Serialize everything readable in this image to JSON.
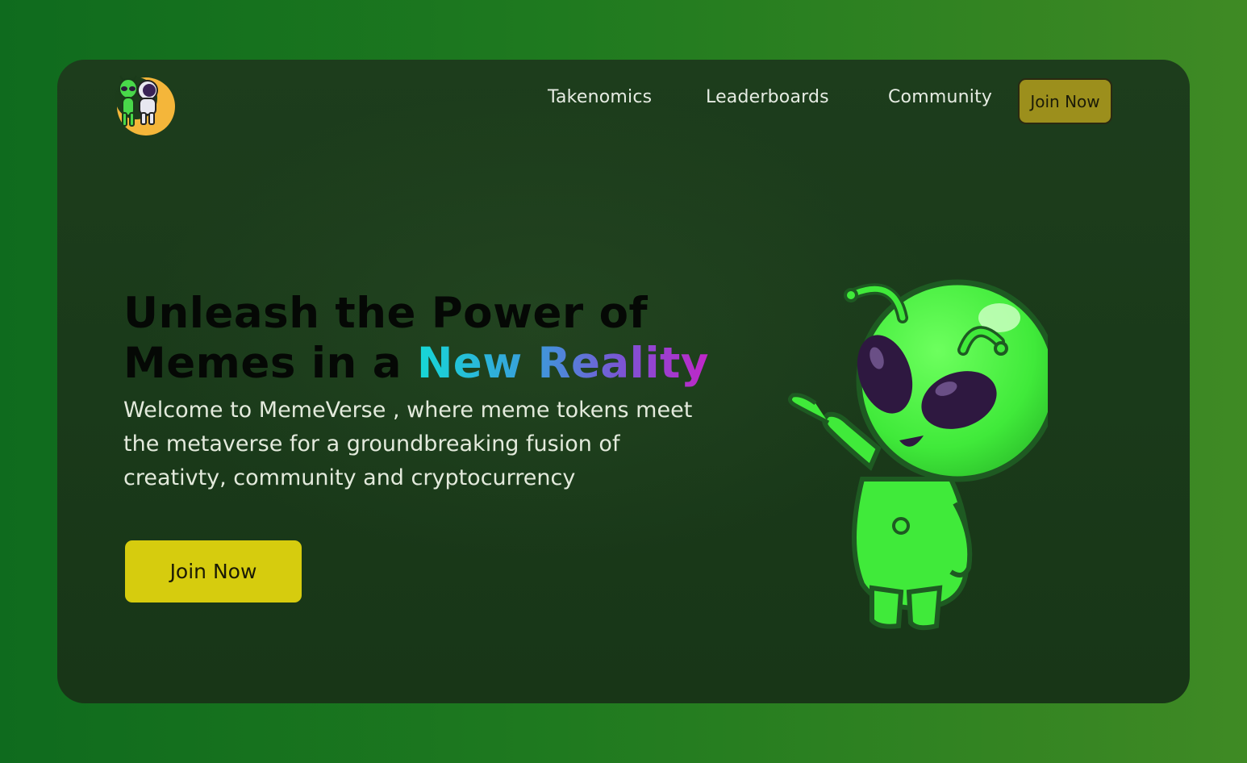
{
  "header": {
    "logo_name": "memeverse-logo",
    "nav": [
      {
        "label": "Takenomics"
      },
      {
        "label": "Leaderboards"
      },
      {
        "label": "Community"
      }
    ],
    "join_label": "Join Now"
  },
  "hero": {
    "title_line1": "Unleash the Power of",
    "title_line2_plain": "Memes in a ",
    "title_line2_highlight": "New Reality",
    "description": "Welcome to MemeVerse , where meme tokens meet the metaverse for a groundbreaking fusion of creativty, community and cryptocurrency",
    "cta_label": "Join Now",
    "illustration": "alien-mascot"
  },
  "colors": {
    "page_background": "#1f7a1f",
    "card_background": "#1b3b1a",
    "nav_join_button": "#9c8f1c",
    "cta_button": "#d6cc0e",
    "title_text": "#050805",
    "highlight_gradient_start": "#16d8d6",
    "highlight_gradient_end": "#c026c8"
  }
}
